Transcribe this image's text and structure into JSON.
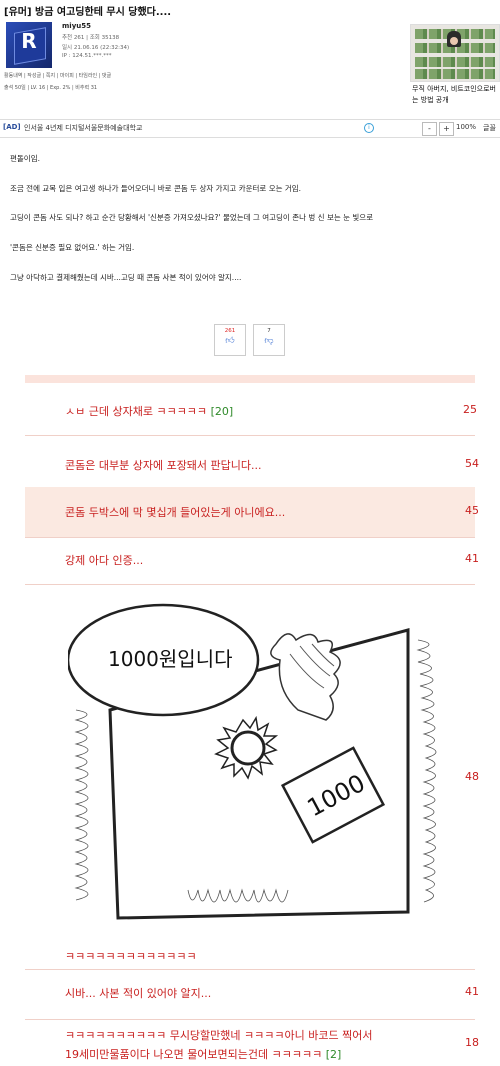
{
  "post": {
    "title": "[유머] 방금 여고딩한테 무시 당했다....",
    "author": "miyu55",
    "meta_line1": "추천 261 | 조회 35138",
    "meta_line2": "일시 21.06.16 (22:32:34)",
    "meta_line3": "IP : 124.51.***.***",
    "user_menu": "활동내역 | 작성글 | 쪽지 | 마이피 | 타임라인 | 댓글",
    "user_stats": "출석 50일 | LV. 16 | Exp. 2% | 비추력 31"
  },
  "side_ad": {
    "caption": "무직 아버지, 비트코인으로버는 방법 공개"
  },
  "ad_bar": {
    "label": "[AD]",
    "text": "인서울 4년제 디지털서울문화예술대학교",
    "minus": "-",
    "plus": "+",
    "zoom": "100%",
    "font_label": "글꼴"
  },
  "content": {
    "lines": [
      "편돌이임.",
      "조금 전에 교복 입은 여고생 하나가 들어오더니 바로 콘돔 두 상자 가지고 카운터로 오는 거임.",
      "고딩이 콘돔 사도 되나? 하고 순간 당황해서 '신분증 가져오셨나요?' 물었는데 그 여고딩이 존나 벙 신 보는 눈 빛으로",
      "'콘돔은 신분증 필요 없어요.' 하는 거임.",
      "그냥 아닥하고 결제해줬는데 시바...고딩 때 콘돔 사본 적이 있어야 알지...."
    ]
  },
  "votes": {
    "up_count": "261",
    "down_count": "7",
    "up_icon": "thumbs-up-icon",
    "down_icon": "thumbs-down-icon"
  },
  "comments": [
    {
      "text": "ㅅㅂ 근데 상자채로 ㅋㅋㅋㅋㅋ",
      "count": "[20]",
      "num": "25"
    },
    {
      "text": "콘돔은 대부분 상자에 포장돼서 판답니다...",
      "count": "",
      "num": "54"
    },
    {
      "text": "콘돔 두박스에 막 몇십개 들어있는게 아니에요...",
      "count": "",
      "num": "45"
    },
    {
      "text": "강제 아다 인증...",
      "count": "",
      "num": "41"
    },
    {
      "text": "ㅋㅋㅋㅋㅋㅋㅋㅋㅋㅋㅋㅋㅋ",
      "count": "",
      "num": "48"
    },
    {
      "text": "시바... 사본 적이 있어야 알지...",
      "count": "",
      "num": "41"
    },
    {
      "text": "ㅋㅋㅋㅋㅋㅋㅋㅋㅋㅋ 무시당할만했네 ㅋㅋㅋㅋ아니 바코드 찍어서",
      "text2": "19세미만물품이다 나오면 물어보면되는건데 ㅋㅋㅋㅋㅋ",
      "count": "[2]",
      "num": "18"
    }
  ],
  "cartoon": {
    "bubble_text": "1000원입니다",
    "money_text": "1000"
  },
  "colors": {
    "comment_red": "#c8201f",
    "highlight_bg": "#fbe9e1",
    "reply_count_green": "#2f8a2a"
  }
}
